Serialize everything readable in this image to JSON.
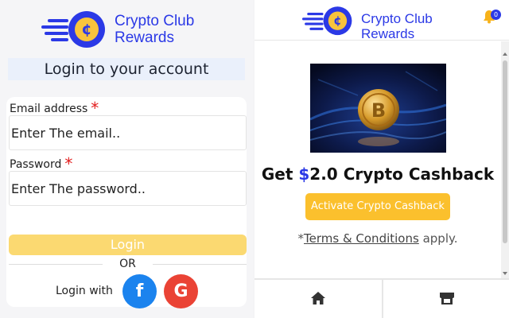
{
  "login": {
    "logo_line1": "Crypto Club",
    "logo_line2": "Rewards",
    "coin_symbol": "¢",
    "title": "Login to your account",
    "email_label": "Email address",
    "email_value": "Enter The email..",
    "password_label": "Password",
    "password_value": "Enter The password..",
    "required_mark": "*",
    "login_button": "Login",
    "or_text": "OR",
    "login_with": "Login with",
    "facebook_letter": "f",
    "google_letter": "G"
  },
  "rewards": {
    "logo_line1": "Crypto Club",
    "logo_line2": "Rewards",
    "coin_symbol": "¢",
    "notification_count": "0",
    "hero_icon": "bitcoin-coin-image",
    "cashback_prefix": "Get ",
    "cashback_dollar": "$",
    "cashback_rest": "2.0 Crypto Cashback",
    "activate_button": "Activate Crypto Cashback",
    "terms_star": "*",
    "terms_link": "Terms & Conditions",
    "terms_suffix": " apply.",
    "footer_tabs": [
      {
        "icon": "home-icon"
      },
      {
        "icon": "store-icon"
      }
    ]
  },
  "colors": {
    "brand_blue": "#2b39e6",
    "coin_gold": "#f9c43c",
    "login_button_yellow": "#fbd971",
    "activate_button_yellow": "#fbc02d",
    "facebook_blue": "#1b83ee",
    "google_red": "#ea4335",
    "required_red": "#e21d1d"
  }
}
